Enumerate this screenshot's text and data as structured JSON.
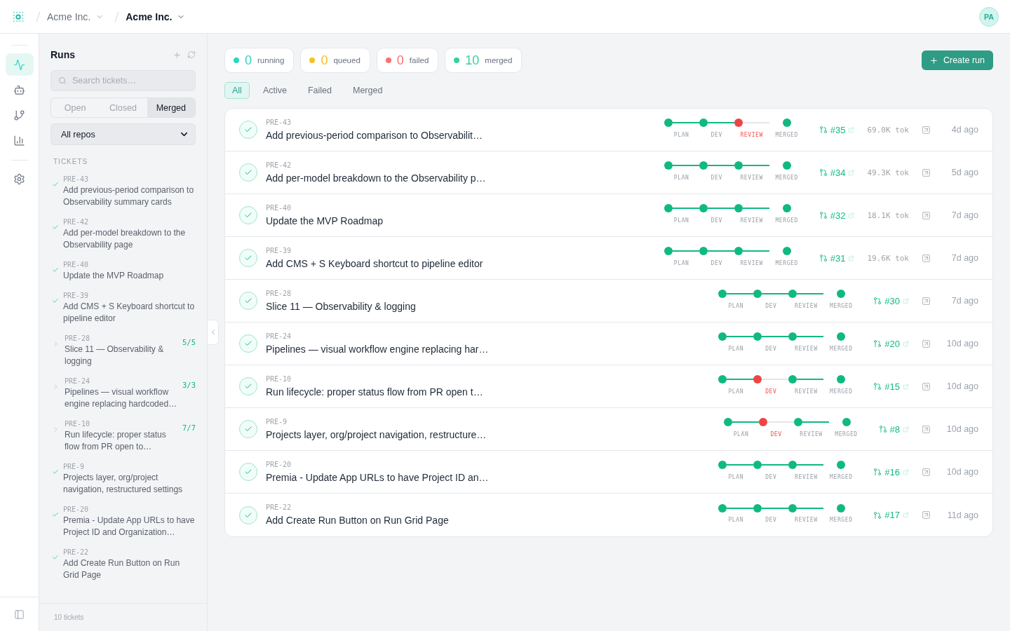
{
  "topbar": {
    "breadcrumbs": [
      {
        "label": "Acme Inc.",
        "current": false
      },
      {
        "label": "Acme Inc.",
        "current": true
      }
    ],
    "avatar": "PA"
  },
  "rail": {
    "items": [
      {
        "selected": true
      },
      {
        "selected": false
      },
      {
        "selected": false
      },
      {
        "selected": false
      }
    ],
    "settings": {
      "selected": false
    }
  },
  "sidebar": {
    "title": "Runs",
    "search": {
      "placeholder": "Search tickets…"
    },
    "segments": [
      {
        "label": "Open",
        "selected": false
      },
      {
        "label": "Closed",
        "selected": false
      },
      {
        "label": "Merged",
        "selected": true
      }
    ],
    "repo_select": {
      "value": "All repos"
    },
    "section_label": "TICKETS",
    "tickets": [
      {
        "kind": "ticket",
        "id": "PRE-43",
        "title": "Add previous-period comparison to Observability summary cards"
      },
      {
        "kind": "ticket",
        "id": "PRE-42",
        "title": "Add per-model breakdown to the Observability page"
      },
      {
        "kind": "ticket",
        "id": "PRE-40",
        "title": "Update the MVP Roadmap"
      },
      {
        "kind": "ticket",
        "id": "PRE-39",
        "title": "Add CMS + S Keyboard shortcut to pipeline editor"
      },
      {
        "kind": "group",
        "id": "PRE-28",
        "title": "Slice 11 — Observability & logging",
        "count": "5/5",
        "expanded": false
      },
      {
        "kind": "group",
        "id": "PRE-24",
        "title": "Pipelines — visual workflow engine replacing hardcoded…",
        "count": "3/3",
        "expanded": false
      },
      {
        "kind": "group",
        "id": "PRE-10",
        "title": "Run lifecycle: proper status flow from PR open to…",
        "count": "7/7",
        "expanded": false
      },
      {
        "kind": "ticket",
        "id": "PRE-9",
        "title": "Projects layer, org/project navigation, restructured settings"
      },
      {
        "kind": "ticket",
        "id": "PRE-20",
        "title": "Premia - Update App URLs to have Project ID and Organization…"
      },
      {
        "kind": "ticket",
        "id": "PRE-22",
        "title": "Add Create Run Button on Run Grid Page"
      }
    ],
    "footer": "10 tickets"
  },
  "stats": [
    {
      "value": "0",
      "label": "running",
      "color": "#2dd4bf"
    },
    {
      "value": "0",
      "label": "queued",
      "color": "#fbbf24"
    },
    {
      "value": "0",
      "label": "failed",
      "color": "#f87171"
    },
    {
      "value": "10",
      "label": "merged",
      "color": "#34d399"
    }
  ],
  "create_button": "Create run",
  "filters": [
    {
      "label": "All",
      "selected": true
    },
    {
      "label": "Active",
      "selected": false
    },
    {
      "label": "Failed",
      "selected": false
    },
    {
      "label": "Merged",
      "selected": false
    }
  ],
  "runs": [
    {
      "id": "PRE-43",
      "title": "Add previous-period comparison to Observabilit…",
      "stages": [
        {
          "label": "PLAN",
          "failed": false
        },
        {
          "label": "DEV",
          "failed": false
        },
        {
          "label": "REVIEW",
          "failed": true
        },
        {
          "label": "MERGED",
          "failed": false
        }
      ],
      "pr": "#35",
      "tokens": "69.0K tok",
      "time": "4d ago"
    },
    {
      "id": "PRE-42",
      "title": "Add per-model breakdown to the Observability p…",
      "stages": [
        {
          "label": "PLAN",
          "failed": false
        },
        {
          "label": "DEV",
          "failed": false
        },
        {
          "label": "REVIEW",
          "failed": false
        },
        {
          "label": "MERGED",
          "failed": false
        }
      ],
      "pr": "#34",
      "tokens": "49.3K tok",
      "time": "5d ago"
    },
    {
      "id": "PRE-40",
      "title": "Update the MVP Roadmap",
      "stages": [
        {
          "label": "PLAN",
          "failed": false
        },
        {
          "label": "DEV",
          "failed": false
        },
        {
          "label": "REVIEW",
          "failed": false
        },
        {
          "label": "MERGED",
          "failed": false
        }
      ],
      "pr": "#32",
      "tokens": "18.1K tok",
      "time": "7d ago"
    },
    {
      "id": "PRE-39",
      "title": "Add CMS + S Keyboard shortcut to pipeline editor",
      "stages": [
        {
          "label": "PLAN",
          "failed": false
        },
        {
          "label": "DEV",
          "failed": false
        },
        {
          "label": "REVIEW",
          "failed": false
        },
        {
          "label": "MERGED",
          "failed": false
        }
      ],
      "pr": "#31",
      "tokens": "19.6K tok",
      "time": "7d ago"
    },
    {
      "id": "PRE-28",
      "title": "Slice 11 — Observability & logging",
      "stages": [
        {
          "label": "PLAN",
          "failed": false
        },
        {
          "label": "DEV",
          "failed": false
        },
        {
          "label": "REVIEW",
          "failed": false
        },
        {
          "label": "MERGED",
          "failed": false
        }
      ],
      "pr": "#30",
      "time": "7d ago"
    },
    {
      "id": "PRE-24",
      "title": "Pipelines — visual workflow engine replacing har…",
      "stages": [
        {
          "label": "PLAN",
          "failed": false
        },
        {
          "label": "DEV",
          "failed": false
        },
        {
          "label": "REVIEW",
          "failed": false
        },
        {
          "label": "MERGED",
          "failed": false
        }
      ],
      "pr": "#20",
      "time": "10d ago"
    },
    {
      "id": "PRE-10",
      "title": "Run lifecycle: proper status flow from PR open t…",
      "stages": [
        {
          "label": "PLAN",
          "failed": false
        },
        {
          "label": "DEV",
          "failed": true
        },
        {
          "label": "REVIEW",
          "failed": false
        },
        {
          "label": "MERGED",
          "failed": false
        }
      ],
      "pr": "#15",
      "time": "10d ago"
    },
    {
      "id": "PRE-9",
      "title": "Projects layer, org/project navigation, restructure…",
      "stages": [
        {
          "label": "PLAN",
          "failed": false
        },
        {
          "label": "DEV",
          "failed": true
        },
        {
          "label": "REVIEW",
          "failed": false
        },
        {
          "label": "MERGED",
          "failed": false
        }
      ],
      "pr": "#8",
      "time": "10d ago"
    },
    {
      "id": "PRE-20",
      "title": "Premia - Update App URLs to have Project ID an…",
      "stages": [
        {
          "label": "PLAN",
          "failed": false
        },
        {
          "label": "DEV",
          "failed": false
        },
        {
          "label": "REVIEW",
          "failed": false
        },
        {
          "label": "MERGED",
          "failed": false
        }
      ],
      "pr": "#16",
      "time": "10d ago"
    },
    {
      "id": "PRE-22",
      "title": "Add Create Run Button on Run Grid Page",
      "stages": [
        {
          "label": "PLAN",
          "failed": false
        },
        {
          "label": "DEV",
          "failed": false
        },
        {
          "label": "REVIEW",
          "failed": false
        },
        {
          "label": "MERGED",
          "failed": false
        }
      ],
      "pr": "#17",
      "time": "11d ago"
    }
  ]
}
